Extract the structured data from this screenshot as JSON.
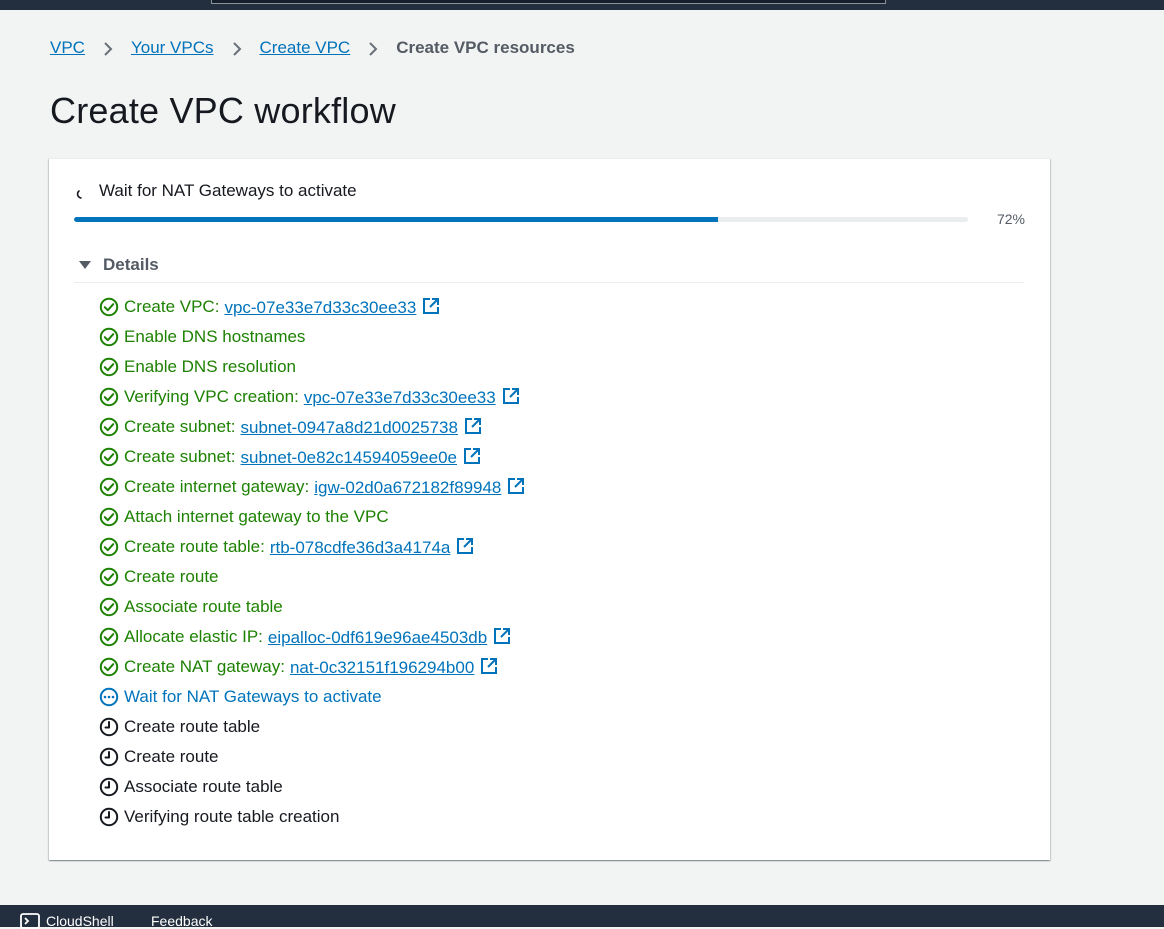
{
  "breadcrumb": {
    "items": [
      {
        "label": "VPC"
      },
      {
        "label": "Your VPCs"
      },
      {
        "label": "Create VPC"
      }
    ],
    "current": "Create VPC resources"
  },
  "page": {
    "title": "Create VPC workflow"
  },
  "status": {
    "current_step": "Wait for NAT Gateways to activate",
    "progress_percent": 72,
    "progress_label": "72%"
  },
  "details": {
    "label": "Details",
    "expanded": true,
    "steps": [
      {
        "text": "Create VPC:",
        "state": "success",
        "link": "vpc-07e33e7d33c30ee33"
      },
      {
        "text": "Enable DNS hostnames",
        "state": "success"
      },
      {
        "text": "Enable DNS resolution",
        "state": "success"
      },
      {
        "text": "Verifying VPC creation:",
        "state": "success",
        "link": "vpc-07e33e7d33c30ee33"
      },
      {
        "text": "Create subnet:",
        "state": "success",
        "link": "subnet-0947a8d21d0025738"
      },
      {
        "text": "Create subnet:",
        "state": "success",
        "link": "subnet-0e82c14594059ee0e"
      },
      {
        "text": "Create internet gateway:",
        "state": "success",
        "link": "igw-02d0a672182f89948"
      },
      {
        "text": "Attach internet gateway to the VPC",
        "state": "success"
      },
      {
        "text": "Create route table:",
        "state": "success",
        "link": "rtb-078cdfe36d3a4174a"
      },
      {
        "text": "Create route",
        "state": "success"
      },
      {
        "text": "Associate route table",
        "state": "success"
      },
      {
        "text": "Allocate elastic IP:",
        "state": "success",
        "link": "eipalloc-0df619e96ae4503db"
      },
      {
        "text": "Create NAT gateway:",
        "state": "success",
        "link": "nat-0c32151f196294b00"
      },
      {
        "text": "Wait for NAT Gateways to activate",
        "state": "in-progress"
      },
      {
        "text": "Create route table",
        "state": "pending"
      },
      {
        "text": "Create route",
        "state": "pending"
      },
      {
        "text": "Associate route table",
        "state": "pending"
      },
      {
        "text": "Verifying route table creation",
        "state": "pending"
      }
    ]
  },
  "footer": {
    "cloudshell_label": "CloudShell",
    "feedback_label": "Feedback"
  },
  "icons": {
    "success": "check-circle-icon",
    "in-progress": "ellipsis-circle-icon",
    "pending": "clock-icon",
    "link": "external-link-icon",
    "spinner": "spinner-icon"
  },
  "colors": {
    "success": "#1d8102",
    "link": "#0073bb",
    "progress": "#0073bb",
    "nav": "#232f3e",
    "background": "#f2f3f3"
  }
}
